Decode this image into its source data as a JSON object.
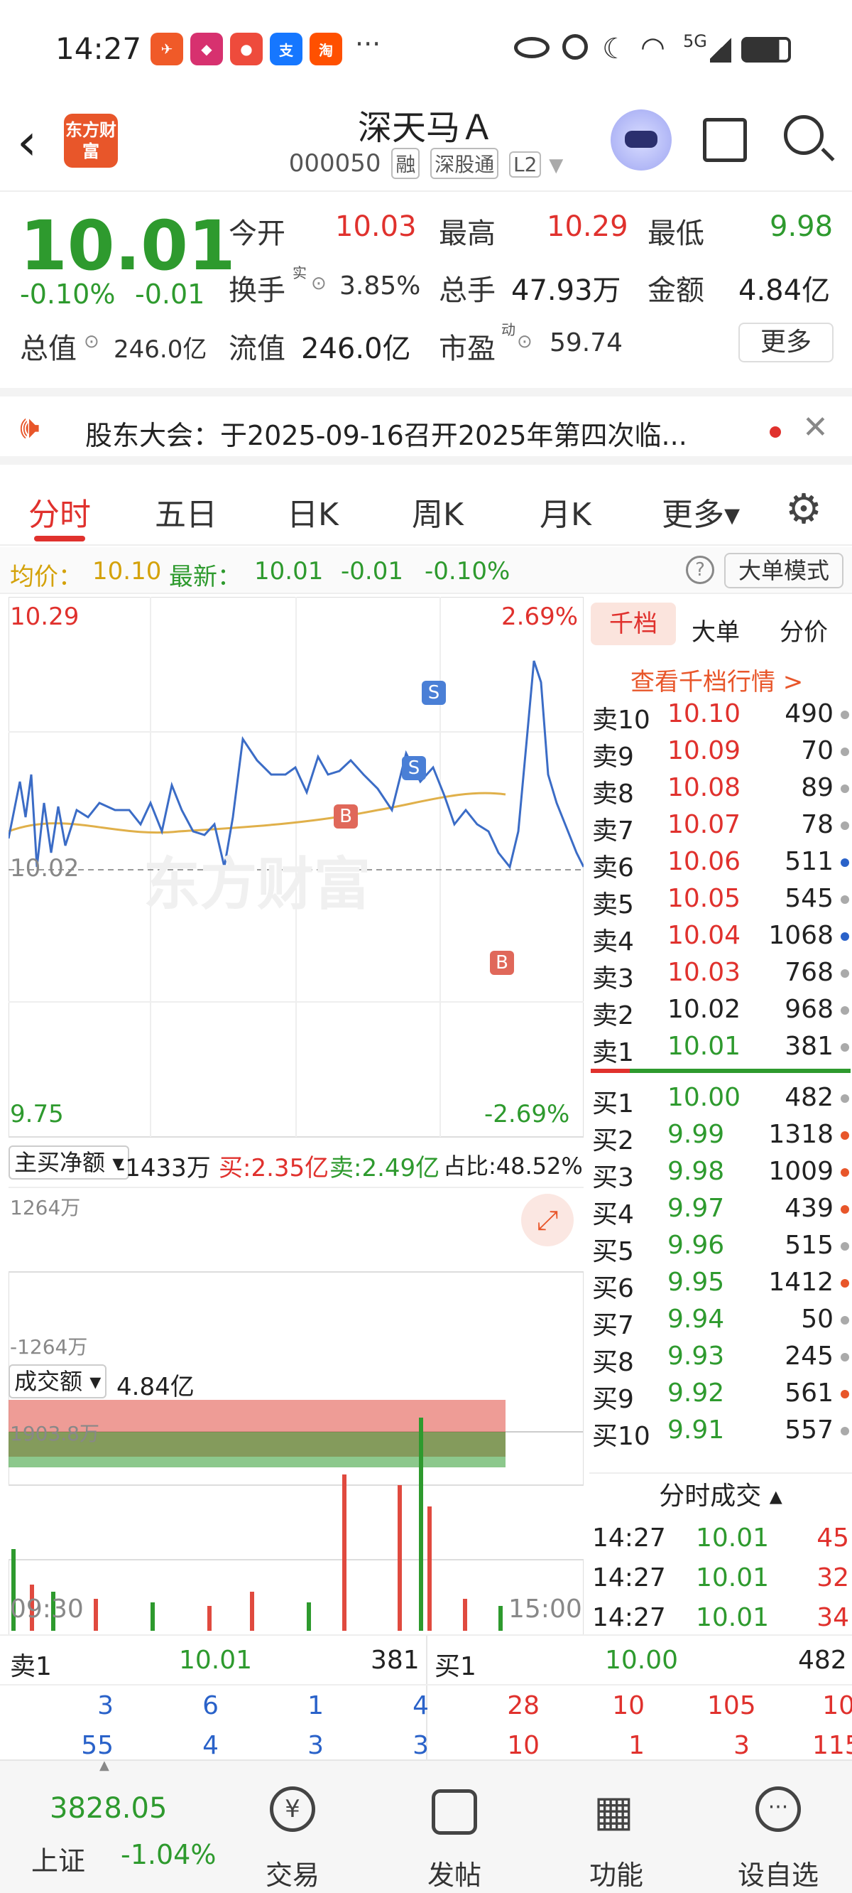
{
  "status_bar": {
    "time": "14:27",
    "dots": "···",
    "network": "5G"
  },
  "header": {
    "title": "深天马Ａ",
    "code": "000050",
    "tags": [
      "融",
      "深股通",
      "L2"
    ],
    "logo_text": "东方财富"
  },
  "quote": {
    "price": "10.01",
    "change_pct": "-0.10%",
    "change": "-0.01",
    "open_label": "今开",
    "open": "10.03",
    "high_label": "最高",
    "high": "10.29",
    "low_label": "最低",
    "low": "9.98",
    "turnover_label": "换手",
    "turnover_sup": "实",
    "turnover": "3.85%",
    "volume_label": "总手",
    "volume": "47.93万",
    "amount_label": "金额",
    "amount": "4.84亿",
    "mktcap_label": "总值",
    "mktcap": "246.0亿",
    "float_label": "流值",
    "float": "246.0亿",
    "pe_label": "市盈",
    "pe_sup": "动",
    "pe": "59.74",
    "more": "更多"
  },
  "notice": {
    "text": "股东大会：于2025-09-16召开2025年第四次临..."
  },
  "tabs": [
    "分时",
    "五日",
    "日K",
    "周K",
    "月K",
    "更多▾"
  ],
  "info": {
    "avg_label": "均价：",
    "avg": "10.10",
    "latest_label": "最新：",
    "latest": "10.01",
    "chg": "-0.01",
    "pct": "-0.10%",
    "mode": "大单模式"
  },
  "chart": {
    "max": "10.29",
    "max_pct": "2.69%",
    "min": "9.75",
    "min_pct": "-2.69%",
    "base": "10.02",
    "watermark": "东方财富",
    "flow_label": "主买净额",
    "flow_value": "-1433万",
    "buy": "买:2.35亿",
    "sell": "卖:2.49亿",
    "ratio": "占比:48.52%",
    "flow_max": "1264万",
    "flow_min": "-1264万",
    "vol_label": "成交额",
    "vol_value": "4.84亿",
    "vol_max": "1903.8万",
    "t_start": "09:30",
    "t_end": "15:00",
    "marker_b": "B",
    "marker_s": "S"
  },
  "book_tabs": [
    "千档",
    "大单",
    "分价"
  ],
  "book_link": "查看千档行情 >",
  "asks": [
    [
      "卖10",
      "10.10",
      "490"
    ],
    [
      "卖9",
      "10.09",
      "70"
    ],
    [
      "卖8",
      "10.08",
      "89"
    ],
    [
      "卖7",
      "10.07",
      "78"
    ],
    [
      "卖6",
      "10.06",
      "511"
    ],
    [
      "卖5",
      "10.05",
      "545"
    ],
    [
      "卖4",
      "10.04",
      "1068"
    ],
    [
      "卖3",
      "10.03",
      "768"
    ],
    [
      "卖2",
      "10.02",
      "968"
    ],
    [
      "卖1",
      "10.01",
      "381"
    ]
  ],
  "bids": [
    [
      "买1",
      "10.00",
      "482"
    ],
    [
      "买2",
      "9.99",
      "1318"
    ],
    [
      "买3",
      "9.98",
      "1009"
    ],
    [
      "买4",
      "9.97",
      "439"
    ],
    [
      "买5",
      "9.96",
      "515"
    ],
    [
      "买6",
      "9.95",
      "1412"
    ],
    [
      "买7",
      "9.94",
      "50"
    ],
    [
      "买8",
      "9.93",
      "245"
    ],
    [
      "买9",
      "9.92",
      "561"
    ],
    [
      "买10",
      "9.91",
      "557"
    ]
  ],
  "ticks_title": "分时成交",
  "ticks": [
    [
      "14:27",
      "10.01",
      "45"
    ],
    [
      "14:27",
      "10.01",
      "32"
    ],
    [
      "14:27",
      "10.01",
      "34"
    ]
  ],
  "bottom": {
    "sell1": [
      "卖1",
      "10.01",
      "381"
    ],
    "buy1": [
      "买1",
      "10.00",
      "482"
    ],
    "sell_row1": [
      "3",
      "6",
      "1",
      "4"
    ],
    "buy_row1": [
      "28",
      "10",
      "105",
      "10"
    ],
    "sell_row2": [
      "55",
      "4",
      "3",
      "3"
    ],
    "buy_row2": [
      "10",
      "1",
      "3",
      "115"
    ]
  },
  "index": {
    "value": "3828.05",
    "name": "上证",
    "pct": "-1.04%"
  },
  "nav": [
    "交易",
    "发帖",
    "功能",
    "设自选"
  ],
  "colors": {
    "red": "#e0312d",
    "green": "#2e9a2e",
    "blue": "#2a62c9"
  }
}
